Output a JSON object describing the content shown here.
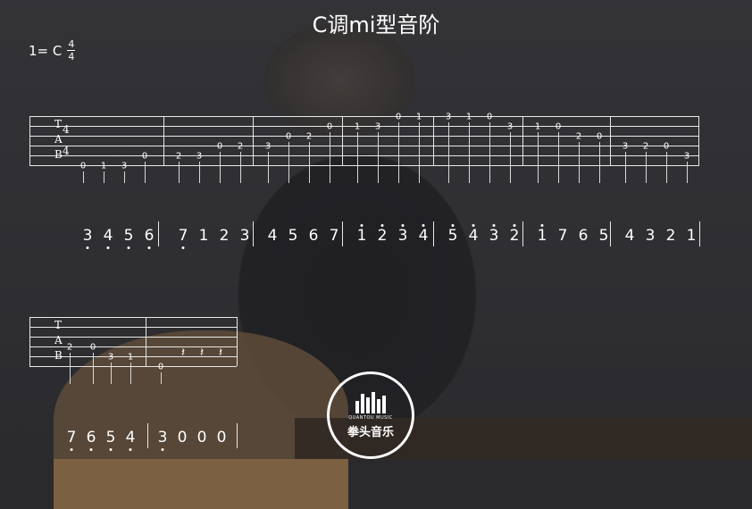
{
  "title": "C调mi型音阶",
  "key": {
    "label": "1= C",
    "numerator": "4",
    "denominator": "4"
  },
  "tab_letters": [
    "T",
    "A",
    "B"
  ],
  "staff1": {
    "time_numerator": "4",
    "time_denominator": "4",
    "frets": [
      {
        "t": "0"
      },
      {
        "t": "1"
      },
      {
        "t": "3"
      },
      {
        "t": "0"
      },
      {
        "t": "2"
      },
      {
        "t": "3"
      },
      {
        "t": "0"
      },
      {
        "t": "2"
      },
      {
        "t": "3"
      },
      {
        "t": "0"
      },
      {
        "t": "2"
      },
      {
        "t": "0"
      },
      {
        "t": "1"
      },
      {
        "t": "3"
      },
      {
        "t": "0"
      },
      {
        "t": "1"
      },
      {
        "t": "3"
      },
      {
        "t": "1"
      },
      {
        "t": "0"
      },
      {
        "t": "3"
      },
      {
        "t": "1"
      },
      {
        "t": "0"
      },
      {
        "t": "2"
      },
      {
        "t": "0"
      },
      {
        "t": "3"
      },
      {
        "t": "2"
      },
      {
        "t": "0"
      },
      {
        "t": "3"
      }
    ]
  },
  "numbers1": [
    {
      "n": "3",
      "dot": "below"
    },
    {
      "n": "4",
      "dot": "below"
    },
    {
      "n": "5",
      "dot": "below"
    },
    {
      "n": "6",
      "dot": "below"
    },
    {
      "n": "7",
      "dot": "below"
    },
    {
      "n": "1",
      "dot": ""
    },
    {
      "n": "2",
      "dot": ""
    },
    {
      "n": "3",
      "dot": ""
    },
    {
      "n": "4",
      "dot": ""
    },
    {
      "n": "5",
      "dot": ""
    },
    {
      "n": "6",
      "dot": ""
    },
    {
      "n": "7",
      "dot": ""
    },
    {
      "n": "1",
      "dot": "above"
    },
    {
      "n": "2",
      "dot": "above"
    },
    {
      "n": "3",
      "dot": "above"
    },
    {
      "n": "4",
      "dot": "above"
    },
    {
      "n": "5",
      "dot": "above"
    },
    {
      "n": "4",
      "dot": "above"
    },
    {
      "n": "3",
      "dot": "above"
    },
    {
      "n": "2",
      "dot": "above"
    },
    {
      "n": "1",
      "dot": "above"
    },
    {
      "n": "7",
      "dot": ""
    },
    {
      "n": "6",
      "dot": ""
    },
    {
      "n": "5",
      "dot": ""
    },
    {
      "n": "4",
      "dot": ""
    },
    {
      "n": "3",
      "dot": ""
    },
    {
      "n": "2",
      "dot": ""
    },
    {
      "n": "1",
      "dot": ""
    }
  ],
  "staff2": {
    "frets": [
      {
        "t": "2"
      },
      {
        "t": "0"
      },
      {
        "t": "3"
      },
      {
        "t": "1"
      },
      {
        "t": "0"
      }
    ],
    "rests": [
      "𝄽",
      "𝄽",
      "𝄽"
    ]
  },
  "numbers2": [
    {
      "n": "7",
      "dot": "below"
    },
    {
      "n": "6",
      "dot": "below"
    },
    {
      "n": "5",
      "dot": "below"
    },
    {
      "n": "4",
      "dot": "below"
    },
    {
      "n": "3",
      "dot": "below"
    },
    {
      "n": "0",
      "dot": ""
    },
    {
      "n": "0",
      "dot": ""
    },
    {
      "n": "0",
      "dot": ""
    }
  ],
  "logo": {
    "sub": "QUANTOU MUSIC",
    "name": "拳头音乐"
  }
}
